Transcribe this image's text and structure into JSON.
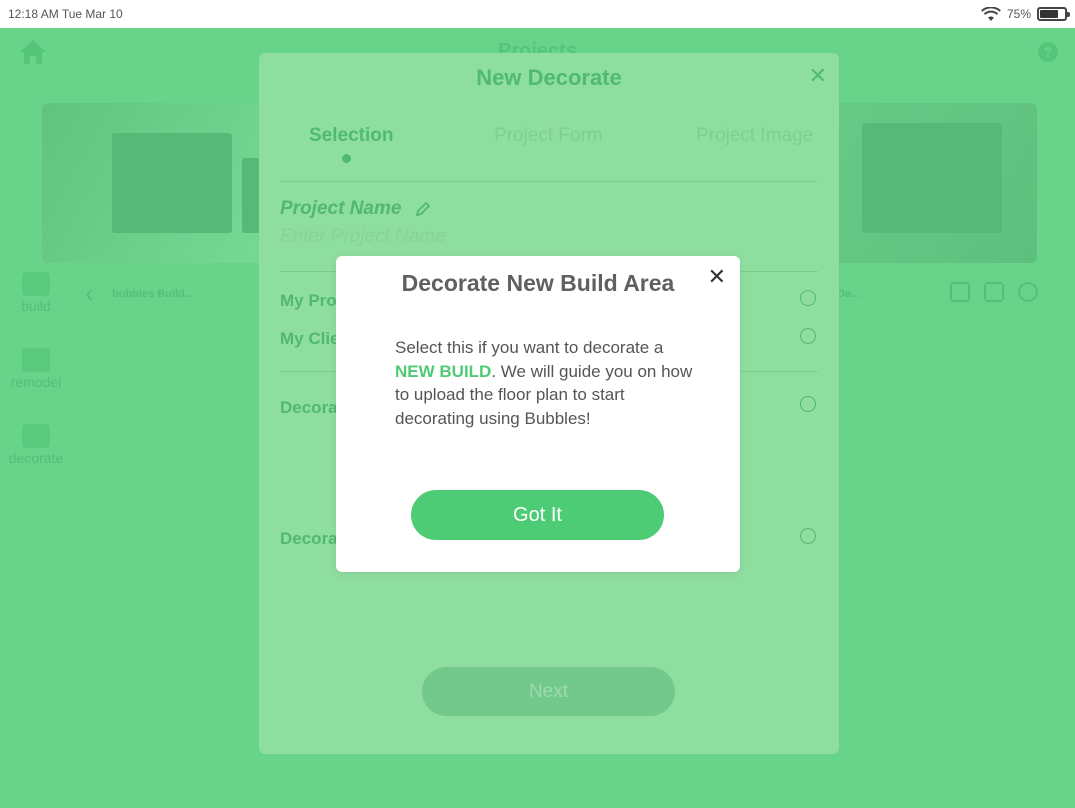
{
  "status_bar": {
    "time": "12:18 AM  Tue Mar 10",
    "battery": "75%",
    "battery_level": 0.75
  },
  "app": {
    "title": "Projects",
    "sidebar": [
      {
        "label": "build",
        "icon": "build-icon"
      },
      {
        "label": "remodel",
        "icon": "remodel-icon"
      },
      {
        "label": "decorate",
        "icon": "sofa-icon"
      }
    ],
    "card_names": [
      "bubbles Build...",
      "De..."
    ]
  },
  "wizard": {
    "title": "New Decorate",
    "steps": [
      "Selection",
      "Project Form",
      "Project Image"
    ],
    "active_step": 0,
    "project_name_label": "Project Name",
    "project_name_placeholder": "Enter Project Name",
    "options": [
      "My Proj",
      "My Clie",
      "Decorat",
      "Decorat"
    ],
    "next_label": "Next"
  },
  "modal": {
    "title": "Decorate New Build Area",
    "body_before": "Select this if you want to decorate a ",
    "body_highlight": "NEW BUILD",
    "body_after": ".  We will guide you on how to upload the floor plan to start decorating using Bubbles!",
    "button_label": "Got It",
    "accent_color": "#4ecb75"
  }
}
